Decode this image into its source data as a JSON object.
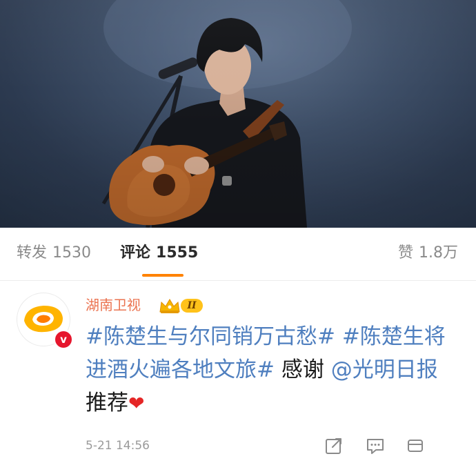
{
  "tabs": {
    "repost": {
      "label": "转发",
      "count": "1530"
    },
    "comment": {
      "label": "评论",
      "count": "1555"
    },
    "like": {
      "label": "赞",
      "count": "1.8万"
    }
  },
  "comment": {
    "username": "湖南卫视",
    "vip_level": "II",
    "verified_symbol": "v",
    "text": {
      "hashtag1": "#陈楚生与尔同销万古愁#",
      "hashtag2": "#陈楚生将进酒火遍各地文旅#",
      "thanks": "感谢",
      "mention": "@光明日报",
      "recommend": "推荐",
      "heart": "❤"
    },
    "time": "5-21 14:56"
  },
  "icons": {
    "share": "share-icon",
    "reply": "comment-icon",
    "like": "like-icon"
  },
  "colors": {
    "accent": "#ff8200",
    "username": "#eb7350",
    "link": "#4f7fbf",
    "heart": "#e52626",
    "verified": "#e6162d"
  }
}
